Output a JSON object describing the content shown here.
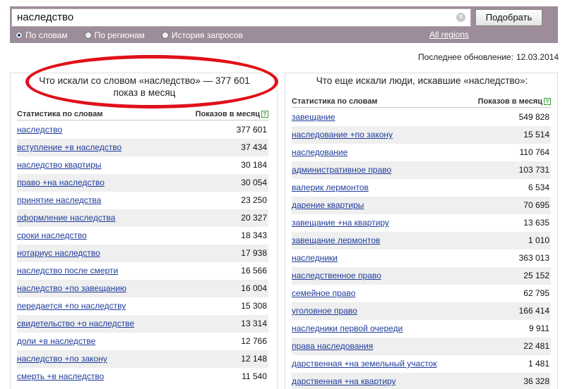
{
  "search": {
    "value": "наследство",
    "clear_icon": "close-circle-icon"
  },
  "toolbar": {
    "pick_label": "Подобрать",
    "all_regions": "All regions"
  },
  "modes": [
    {
      "label": "По словам",
      "selected": true
    },
    {
      "label": "По регионам",
      "selected": false
    },
    {
      "label": "История запросов",
      "selected": false
    }
  ],
  "updated": {
    "label": "Последнее обновление:",
    "date": "12.03.2014"
  },
  "left": {
    "title_line1": "Что искали со словом «наследство» — 377 601",
    "title_line2": "показ в месяц",
    "col_words": "Статистика по словам",
    "col_shows": "Показов в месяц",
    "rows": [
      {
        "kw": "наследство",
        "count": "377 601"
      },
      {
        "kw": "вступление +в наследство",
        "count": "37 434"
      },
      {
        "kw": "наследство квартиры",
        "count": "30 184"
      },
      {
        "kw": "право +на наследство",
        "count": "30 054"
      },
      {
        "kw": "принятие наследства",
        "count": "23 250"
      },
      {
        "kw": "оформление наследства",
        "count": "20 327"
      },
      {
        "kw": "сроки наследство",
        "count": "18 343"
      },
      {
        "kw": "нотариус наследство",
        "count": "17 938"
      },
      {
        "kw": "наследство после смерти",
        "count": "16 566"
      },
      {
        "kw": "наследство +по завещанию",
        "count": "16 004"
      },
      {
        "kw": "передается +по наследству",
        "count": "15 308"
      },
      {
        "kw": "свидетельство +о наследстве",
        "count": "13 314"
      },
      {
        "kw": "доли +в наследстве",
        "count": "12 766"
      },
      {
        "kw": "наследство +по закону",
        "count": "12 148"
      },
      {
        "kw": "смерть +в наследство",
        "count": "11 540"
      }
    ]
  },
  "right": {
    "title": "Что еще искали люди, искавшие «наследство»:",
    "col_words": "Статистика по словам",
    "col_shows": "Показов в месяц",
    "rows": [
      {
        "kw": "завещание",
        "count": "549 828"
      },
      {
        "kw": "наследование +по закону",
        "count": "15 514"
      },
      {
        "kw": "наследование",
        "count": "110 764"
      },
      {
        "kw": "административное право",
        "count": "103 731"
      },
      {
        "kw": "валерик лермонтов",
        "count": "6 534"
      },
      {
        "kw": "дарение квартиры",
        "count": "70 695"
      },
      {
        "kw": "завещание +на квартиру",
        "count": "13 635"
      },
      {
        "kw": "завещание лермонтов",
        "count": "1 010"
      },
      {
        "kw": "наследники",
        "count": "363 013"
      },
      {
        "kw": "наследственное право",
        "count": "25 152"
      },
      {
        "kw": "семейное право",
        "count": "62 795"
      },
      {
        "kw": "уголовное право",
        "count": "166 414"
      },
      {
        "kw": "наследники первой очереди",
        "count": "9 911"
      },
      {
        "kw": "права наследования",
        "count": "22 481"
      },
      {
        "kw": "дарственная +на земельный участок",
        "count": "1 481"
      },
      {
        "kw": "дарственная +на квартиру",
        "count": "36 328"
      }
    ]
  },
  "colors": {
    "topbar": "#9d8c99",
    "link": "#1f3c9a",
    "highlight": "#e0101a",
    "stripe": "#efefef"
  }
}
